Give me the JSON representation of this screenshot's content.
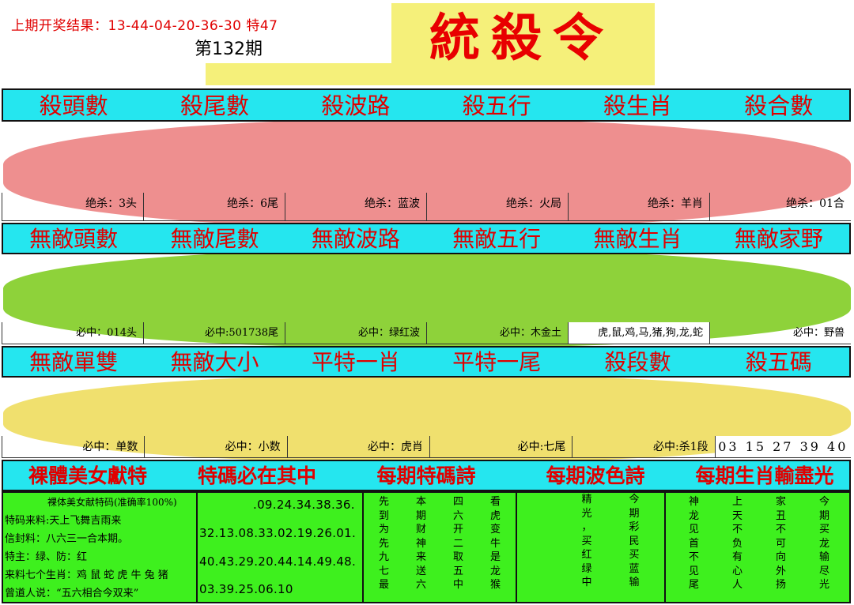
{
  "header": {
    "last_result": "上期开奖结果：13-44-04-20-36-30 特47",
    "issue": "第132期",
    "title": "統殺令"
  },
  "row1": {
    "titles": [
      "殺頭數",
      "殺尾數",
      "殺波路",
      "殺五行",
      "殺生肖",
      "殺合數"
    ],
    "answers": [
      "绝杀：3头",
      "绝杀：6尾",
      "绝杀：蓝波",
      "绝杀：火局",
      "绝杀：羊肖",
      "绝杀：01合"
    ]
  },
  "row2": {
    "titles": [
      "無敵頭數",
      "無敵尾數",
      "無敵波路",
      "無敵五行",
      "無敵生肖",
      "無敵家野"
    ],
    "answers": [
      "必中：014头",
      "必中:501738尾",
      "必中：绿红波",
      "必中：木金土",
      "虎,鼠,鸡,马,猪,狗,龙,蛇",
      "必中：野兽"
    ]
  },
  "row3": {
    "titles": [
      "無敵單雙",
      "無敵大小",
      "平特一肖",
      "平特一尾",
      "殺段數",
      "殺五碼"
    ],
    "answers": [
      "必中：单数",
      "必中：小数",
      "必中：虎肖",
      "必中:七尾",
      "必中:杀1段",
      "03 15 27 39 40"
    ]
  },
  "row4": {
    "titles": [
      "裸體美女獻特",
      "特碼必在其中",
      "每期特碼詩",
      "每期波色詩",
      "每期生肖輸盡光"
    ]
  },
  "panel1": {
    "title": "裸体美女献特码(准确率100%)",
    "lines": [
      "特码来料:天上飞舞吉雨来",
      "信封料：八六三一合本期。",
      "特主：绿、防：红",
      "来料七个生肖：鸡 鼠 蛇 虎 牛 兔 猪",
      "曾道人说：“五六相合今双来”"
    ]
  },
  "panel2": {
    "lines": [
      ".09.24.34.38.36.",
      "32.13.08.33.02.19.26.01.",
      "40.43.29.20.44.14.49.48.",
      "03.39.25.06.10"
    ]
  },
  "poem_tema": [
    "先",
    "本",
    "四",
    "看",
    "到",
    "期",
    "六",
    "虎",
    "为",
    "财",
    "开",
    "变",
    "先",
    "神",
    "二",
    "牛",
    "九",
    "来",
    "取",
    "是",
    "七",
    "送",
    "五",
    "龙",
    "最",
    "六",
    "中",
    "猴"
  ],
  "poem_bose": [
    "精",
    "今",
    "光",
    "期",
    "，",
    "彩",
    "买",
    "民",
    "红",
    "买",
    "绿",
    "蓝",
    "中",
    "输"
  ],
  "poem_shengxiao": [
    "神",
    "上",
    "家",
    "今",
    "龙",
    "天",
    "丑",
    "期",
    "见",
    "不",
    "不",
    "买",
    "首",
    "负",
    "可",
    "龙",
    "不",
    "有",
    "向",
    "输",
    "见",
    "心",
    "外",
    "尽",
    "尾",
    "人",
    "扬",
    "光"
  ],
  "colors": {
    "title_red": "#e00000",
    "bar_cyan": "#25e6ef",
    "pink": "#ee8f8f",
    "green": "#8ed23a",
    "yellow": "#f0e06e",
    "bottom_green": "#3ef01e"
  }
}
